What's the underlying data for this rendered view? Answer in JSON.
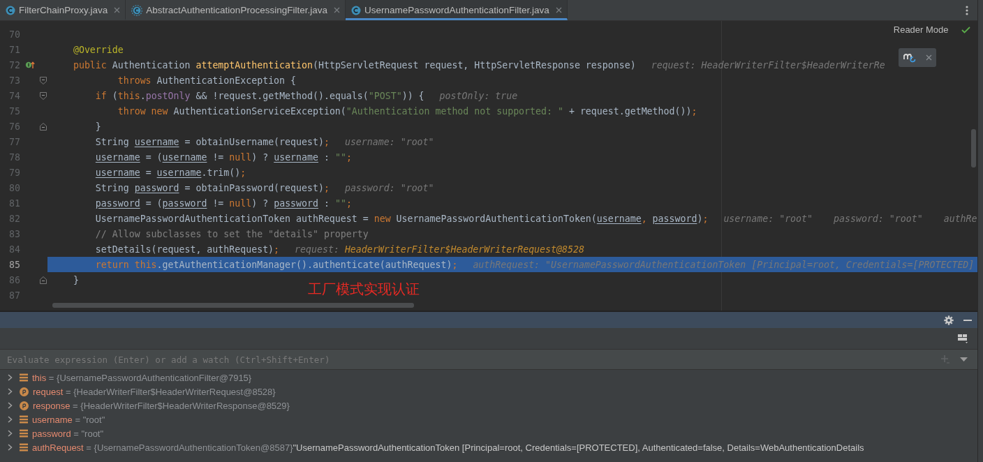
{
  "tabs": [
    {
      "label": "FilterChainProxy.java",
      "kind": "class",
      "selected": false
    },
    {
      "label": "AbstractAuthenticationProcessingFilter.java",
      "kind": "abstract",
      "selected": false
    },
    {
      "label": "UsernamePasswordAuthenticationFilter.java",
      "kind": "class",
      "selected": true
    }
  ],
  "editor": {
    "reader_mode": "Reader Mode",
    "lines": [
      {
        "number": "70",
        "selected": false
      },
      {
        "number": "71",
        "selected": false,
        "tokens": [
          {
            "t": "    @Override",
            "kind": "ann"
          }
        ]
      },
      {
        "number": "72",
        "selected": false,
        "gutter": {
          "kind": "implements"
        },
        "tokens": [
          {
            "t": "    public",
            "kind": "kw"
          },
          {
            "t": " Authentication ",
            "kind": "pl"
          },
          {
            "t": "attemptAuthentication",
            "kind": "fn"
          },
          {
            "t": "(HttpServletRequest request, HttpServletResponse response)",
            "kind": "pl"
          }
        ],
        "hints": [
          [
            {
              "t": "request: HeaderWriterFilter$HeaderWriterRe",
              "kind": "hint"
            }
          ]
        ]
      },
      {
        "number": "73",
        "selected": false,
        "fold": {
          "kind": "start"
        },
        "tokens": [
          {
            "t": "            throws",
            "kind": "kw"
          },
          {
            "t": " AuthenticationException {",
            "kind": "pl"
          }
        ]
      },
      {
        "number": "74",
        "selected": false,
        "fold": {
          "kind": "start"
        },
        "tokens": [
          {
            "t": "        if",
            "kind": "kw"
          },
          {
            "t": " (",
            "kind": "pl"
          },
          {
            "t": "this",
            "kind": "kw"
          },
          {
            "t": ".",
            "kind": "pl"
          },
          {
            "t": "postOnly",
            "kind": "field"
          },
          {
            "t": " && !request.getMethod().equals(",
            "kind": "pl"
          },
          {
            "t": "\"POST\"",
            "kind": "str"
          },
          {
            "t": ")) {",
            "kind": "pl"
          }
        ],
        "hints": [
          [
            {
              "t": "postOnly: true",
              "kind": "hint"
            }
          ]
        ]
      },
      {
        "number": "75",
        "selected": false,
        "tokens": [
          {
            "t": "            throw new",
            "kind": "kw"
          },
          {
            "t": " AuthenticationServiceException(",
            "kind": "pl"
          },
          {
            "t": "\"Authentication method not supported: \"",
            "kind": "str"
          },
          {
            "t": " + request.getMethod())",
            "kind": "pl"
          },
          {
            "t": ";",
            "kind": "kw"
          }
        ]
      },
      {
        "number": "76",
        "selected": false,
        "fold": {
          "kind": "end"
        },
        "tokens": [
          {
            "t": "        }",
            "kind": "pl"
          }
        ]
      },
      {
        "number": "77",
        "selected": false,
        "tokens": [
          {
            "t": "        String ",
            "kind": "pl"
          },
          {
            "t": "username",
            "kind": "var"
          },
          {
            "t": " = obtainUsername(request)",
            "kind": "pl"
          },
          {
            "t": ";",
            "kind": "kw"
          }
        ],
        "hints": [
          [
            {
              "t": "username: \"root\"",
              "kind": "hint"
            }
          ]
        ]
      },
      {
        "number": "78",
        "selected": false,
        "tokens": [
          {
            "t": "        username",
            "kind": "var"
          },
          {
            "t": " = (",
            "kind": "pl"
          },
          {
            "t": "username",
            "kind": "var"
          },
          {
            "t": " != ",
            "kind": "pl"
          },
          {
            "t": "null",
            "kind": "kw"
          },
          {
            "t": ") ? ",
            "kind": "pl"
          },
          {
            "t": "username",
            "kind": "var"
          },
          {
            "t": " : ",
            "kind": "pl"
          },
          {
            "t": "\"\"",
            "kind": "str"
          },
          {
            "t": ";",
            "kind": "kw"
          }
        ]
      },
      {
        "number": "79",
        "selected": false,
        "tokens": [
          {
            "t": "        username",
            "kind": "var"
          },
          {
            "t": " = ",
            "kind": "pl"
          },
          {
            "t": "username",
            "kind": "var"
          },
          {
            "t": ".trim()",
            "kind": "pl"
          },
          {
            "t": ";",
            "kind": "kw"
          }
        ]
      },
      {
        "number": "80",
        "selected": false,
        "tokens": [
          {
            "t": "        String ",
            "kind": "pl"
          },
          {
            "t": "password",
            "kind": "var"
          },
          {
            "t": " = obtainPassword(request)",
            "kind": "pl"
          },
          {
            "t": ";",
            "kind": "kw"
          }
        ],
        "hints": [
          [
            {
              "t": "password: \"root\"",
              "kind": "hint"
            }
          ]
        ]
      },
      {
        "number": "81",
        "selected": false,
        "tokens": [
          {
            "t": "        password",
            "kind": "var"
          },
          {
            "t": " = (",
            "kind": "pl"
          },
          {
            "t": "password",
            "kind": "var"
          },
          {
            "t": " != ",
            "kind": "pl"
          },
          {
            "t": "null",
            "kind": "kw"
          },
          {
            "t": ") ? ",
            "kind": "pl"
          },
          {
            "t": "password",
            "kind": "var"
          },
          {
            "t": " : ",
            "kind": "pl"
          },
          {
            "t": "\"\"",
            "kind": "str"
          },
          {
            "t": ";",
            "kind": "kw"
          }
        ]
      },
      {
        "number": "82",
        "selected": false,
        "tokens": [
          {
            "t": "        UsernamePasswordAuthenticationToken authRequest = ",
            "kind": "pl"
          },
          {
            "t": "new",
            "kind": "kw"
          },
          {
            "t": " UsernamePasswordAuthenticationToken(",
            "kind": "pl"
          },
          {
            "t": "username",
            "kind": "var"
          },
          {
            "t": ", ",
            "kind": "kw"
          },
          {
            "t": "password",
            "kind": "var"
          },
          {
            "t": ")",
            "kind": "pl"
          },
          {
            "t": ";",
            "kind": "kw"
          }
        ],
        "hints": [
          [
            {
              "t": "username: \"root\"",
              "kind": "hint"
            }
          ],
          [
            {
              "t": "password: \"root\"",
              "kind": "hint"
            }
          ],
          [
            {
              "t": "authRe",
              "kind": "hint"
            }
          ]
        ]
      },
      {
        "number": "83",
        "selected": false,
        "tokens": [
          {
            "t": "        // Allow subclasses to set the \"details\" property",
            "kind": "comment"
          }
        ]
      },
      {
        "number": "84",
        "selected": false,
        "tokens": [
          {
            "t": "        setDetails(request, authRequest)",
            "kind": "pl"
          },
          {
            "t": ";",
            "kind": "kw"
          }
        ],
        "hints": [
          [
            {
              "t": "request: ",
              "kind": "hint"
            },
            {
              "t": "HeaderWriterFilter$HeaderWriterRequest@8528",
              "kind": "hintref"
            }
          ]
        ]
      },
      {
        "number": "85",
        "selected": true,
        "tokens": [
          {
            "t": "        return ",
            "kind": "kw"
          },
          {
            "t": "this",
            "kind": "kw"
          },
          {
            "t": ".getAuthenticationManager().authenticate(authRequest)",
            "kind": "pl"
          },
          {
            "t": ";",
            "kind": "kw"
          }
        ],
        "hints": [
          [
            {
              "t": "authRequest: \"UsernamePasswordAuthenticationToken [Principal=root, Credentials=[PROTECTED]",
              "kind": "hint"
            }
          ]
        ]
      },
      {
        "number": "86",
        "selected": false,
        "fold": {
          "kind": "end"
        },
        "tokens": [
          {
            "t": "    }",
            "kind": "pl"
          }
        ]
      },
      {
        "number": "87",
        "selected": false
      }
    ]
  },
  "annotation": "工厂模式实现认证",
  "debugger": {
    "evaluate": {
      "placeholder": "Evaluate expression (Enter) or add a watch (Ctrl+Shift+Enter)"
    },
    "variables": [
      {
        "kind": "field",
        "name": "this",
        "value": "= {UsernamePasswordAuthenticationFilter@7915}",
        "expanded": false
      },
      {
        "kind": "param",
        "name": "request",
        "value": "= {HeaderWriterFilter$HeaderWriterRequest@8528}",
        "expanded": false
      },
      {
        "kind": "param",
        "name": "response",
        "value": "= {HeaderWriterFilter$HeaderWriterResponse@8529}",
        "expanded": false
      },
      {
        "kind": "field",
        "name": "username",
        "value": "= \"root\"",
        "expanded": false
      },
      {
        "kind": "field",
        "name": "password",
        "value": "= \"root\"",
        "expanded": false
      },
      {
        "kind": "field",
        "name": "authRequest",
        "value": "= {UsernamePasswordAuthenticationToken@8587}",
        "string": "\"UsernamePasswordAuthenticationToken [Principal=root, Credentials=[PROTECTED], Authenticated=false, Details=WebAuthenticationDetails",
        "expanded": false
      }
    ]
  }
}
